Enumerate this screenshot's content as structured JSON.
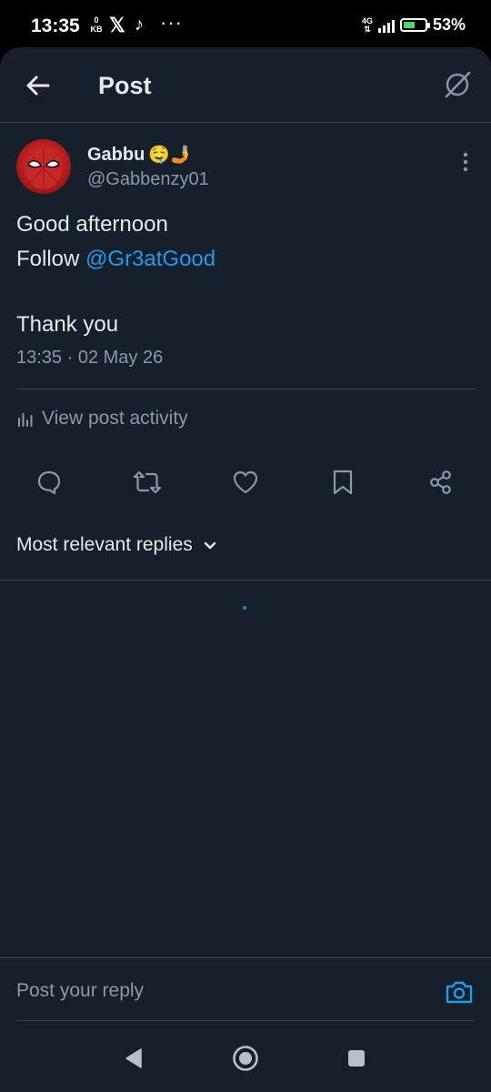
{
  "status_bar": {
    "time": "13:35",
    "net_speed_value": "0",
    "net_speed_unit": "KB",
    "network": "4G",
    "battery": "53%",
    "battery_level": 0.53,
    "more_notifications": "···"
  },
  "header": {
    "title": "Post"
  },
  "post": {
    "author_name": "Gabbu",
    "author_emoji": "🤤🤳",
    "handle": "@Gabbenzy01",
    "line1": "Good afternoon",
    "line2_prefix": "Follow ",
    "mention": "@Gr3atGood",
    "line3": "Thank you",
    "timestamp": "13:35 · 02 May 26",
    "view_activity": "View post activity"
  },
  "replies": {
    "sort_label": "Most relevant replies"
  },
  "reply_box": {
    "placeholder": "Post your reply"
  },
  "colors": {
    "background": "#15202b",
    "accent": "#1d9bf0",
    "text_primary": "#e7e9ea",
    "text_secondary": "#8b98a5",
    "divider": "#38444d"
  },
  "icons": {
    "back": "arrow-left-icon",
    "grok": "grok-icon",
    "more": "more-vertical-icon",
    "activity": "bar-chart-icon",
    "reply": "reply-icon",
    "repost": "repost-icon",
    "like": "heart-icon",
    "bookmark": "bookmark-icon",
    "share": "share-icon",
    "sort": "chevron-down-icon",
    "camera": "camera-icon",
    "nav_back": "triangle-back-icon",
    "nav_home": "circle-home-icon",
    "nav_recents": "square-recents-icon"
  }
}
